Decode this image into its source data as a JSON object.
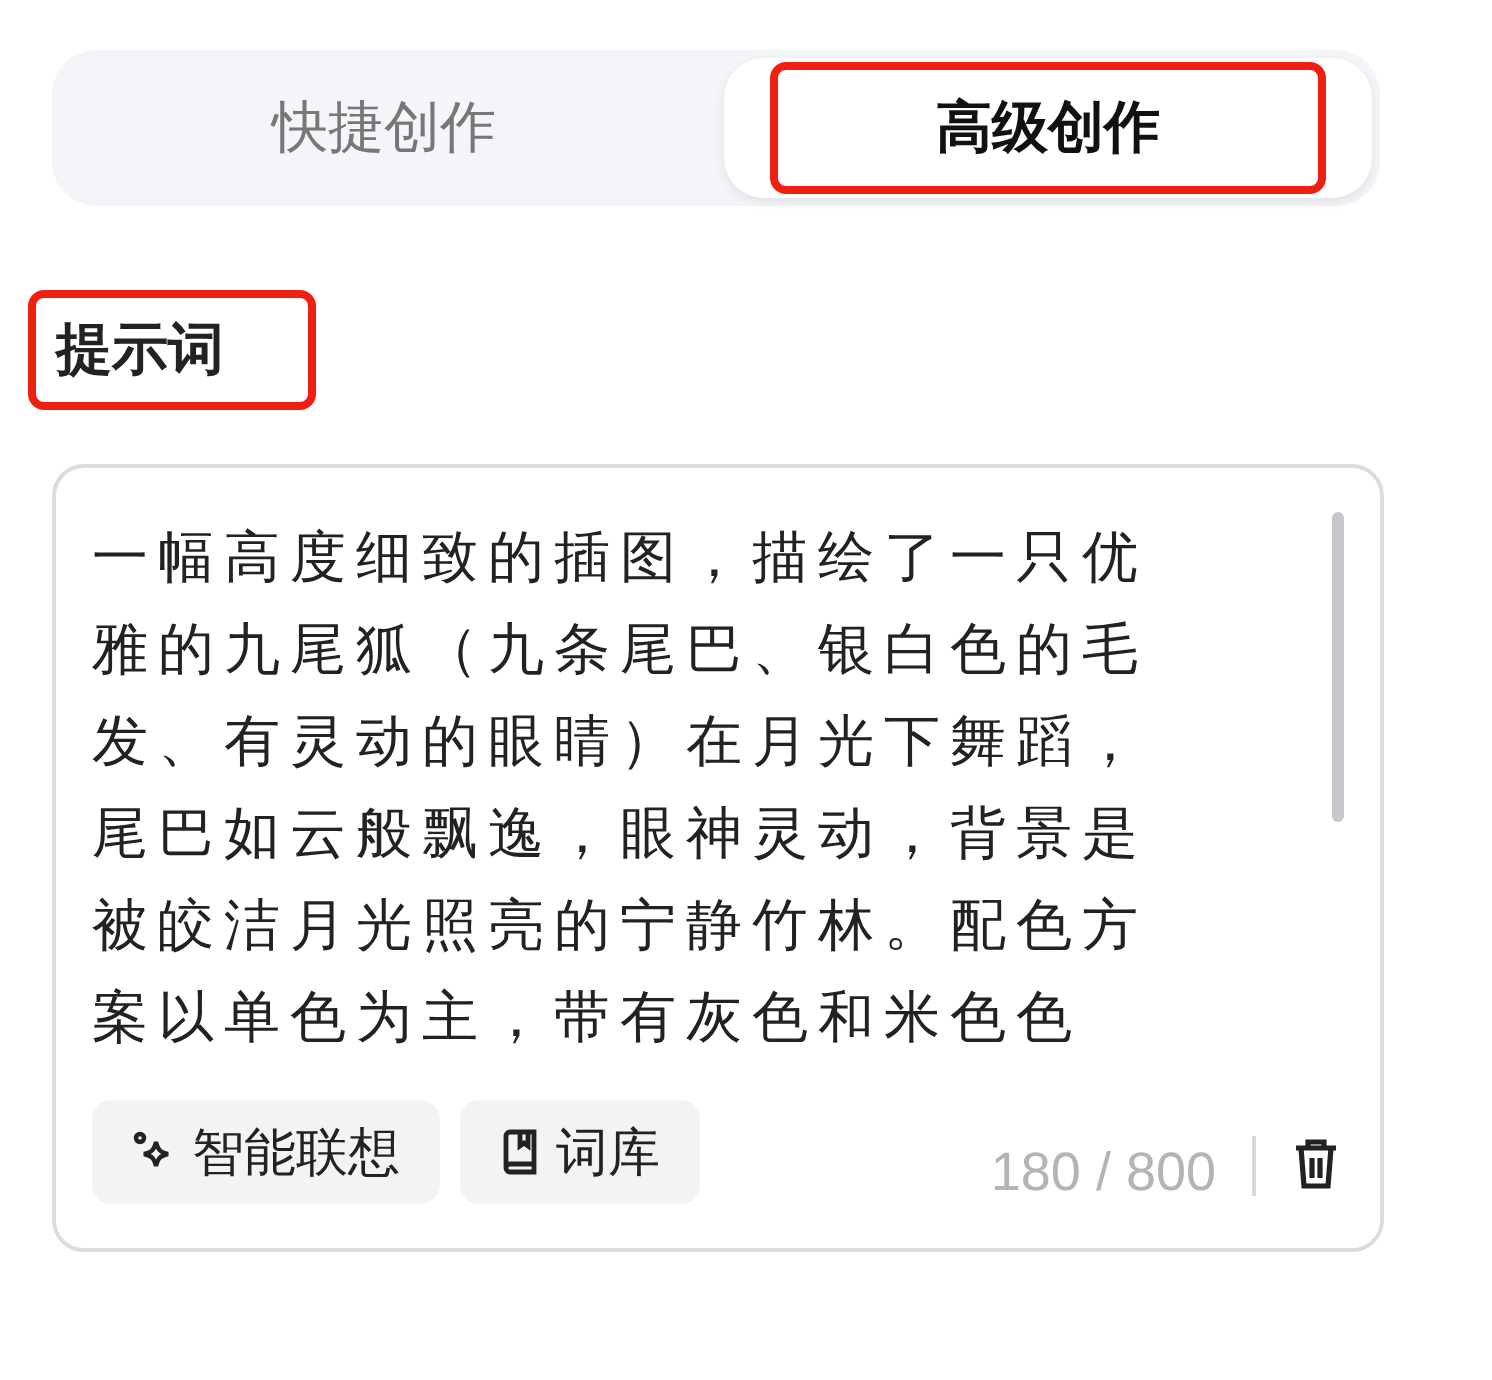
{
  "tabs": [
    {
      "label": "快捷创作",
      "selected": false,
      "highlighted": false
    },
    {
      "label": "高级创作",
      "selected": true,
      "highlighted": true
    }
  ],
  "prompt": {
    "label": "提示词",
    "highlighted": true,
    "value": "一幅高度细致的插图，描绘了一只优雅的九尾狐（九条尾巴、银白色的毛发、有灵动的眼睛）在月光下舞蹈，尾巴如云般飘逸，眼神灵动，背景是被皎洁月光照亮的宁静竹林。配色方案以单色为主，带有灰色和米色色",
    "tools": [
      {
        "kind": "sparkle",
        "label": "智能联想"
      },
      {
        "kind": "book",
        "label": "词库"
      }
    ],
    "count": "180 / 800"
  }
}
